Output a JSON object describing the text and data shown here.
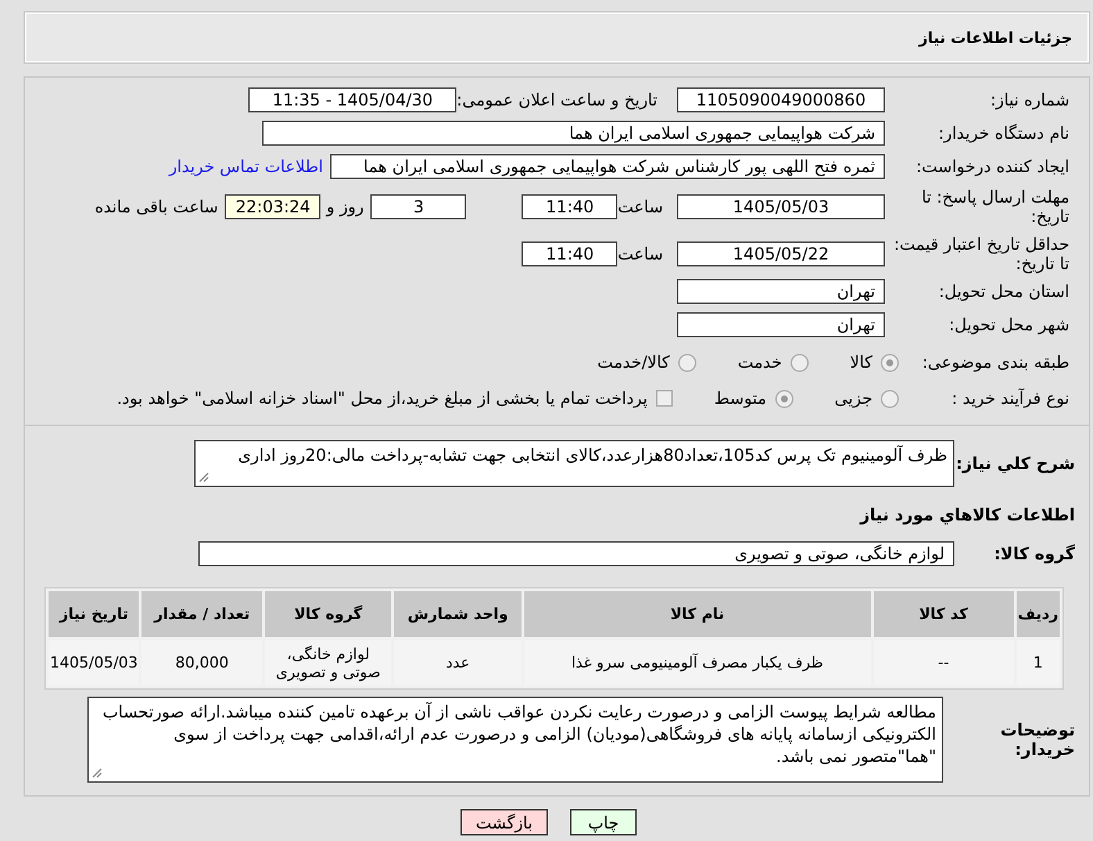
{
  "header": {
    "title": "جزئیات اطلاعات نیاز"
  },
  "fields": {
    "need_number_label": "شماره نیاز:",
    "need_number": "1105090049000860",
    "announce_label": "تاریخ و ساعت اعلان عمومی:",
    "announce_value": "1405/04/30 - 11:35",
    "buyer_label": "نام دستگاه خریدار:",
    "buyer": "شرکت هواپیمایی جمهوری اسلامی ایران هما",
    "requester_label": "ایجاد کننده درخواست:",
    "requester": "ثمره فتح اللهی پور کارشناس شرکت هواپیمایی جمهوری اسلامی ایران هما",
    "contact_link": "اطلاعات تماس خریدار",
    "deadline_label": "مهلت ارسال پاسخ: تا تاریخ:",
    "deadline_date": "1405/05/03",
    "deadline_time_label": "ساعت",
    "deadline_time": "11:40",
    "days": "3",
    "days_label": "روز و",
    "remaining": "22:03:24",
    "remaining_label": "ساعت باقی مانده",
    "validity_label": "حداقل تاریخ اعتبار قیمت: تا تاریخ:",
    "validity_date": "1405/05/22",
    "validity_time_label": "ساعت",
    "validity_time": "11:40",
    "province_label": "استان محل تحویل:",
    "province": "تهران",
    "city_label": "شهر محل تحویل:",
    "city": "تهران"
  },
  "category": {
    "label": "طبقه بندی موضوعی:",
    "options": [
      {
        "label": "کالا",
        "selected": true
      },
      {
        "label": "خدمت",
        "selected": false
      },
      {
        "label": "کالا/خدمت",
        "selected": false
      }
    ]
  },
  "process": {
    "label": "نوع فرآیند خرید :",
    "options": [
      {
        "label": "جزیی",
        "selected": false
      },
      {
        "label": "متوسط",
        "selected": true
      }
    ],
    "payment_checked": false,
    "payment_text": "پرداخت تمام یا بخشی از مبلغ خرید،از محل \"اسناد خزانه اسلامی\" خواهد بود."
  },
  "description": {
    "label": "شرح کلي نياز:",
    "text": "ظرف آلومینیوم تک پرس کد105،تعداد80هزارعدد،کالای انتخابی جهت تشابه-پرداخت مالی:20روز اداری"
  },
  "goods_heading": "اطلاعات کالاهاي مورد نياز",
  "goods_group": {
    "label": "گروه کالا:",
    "value": "لوازم خانگی، صوتی و تصویری"
  },
  "table": {
    "columns": [
      "ردیف",
      "کد کالا",
      "نام کالا",
      "واحد شمارش",
      "گروه کالا",
      "تعداد / مقدار",
      "تاریخ نیاز"
    ],
    "rows": [
      [
        "1",
        "--",
        "ظرف یکبار مصرف آلومینیومی سرو غذا",
        "عدد",
        "لوازم خانگی، صوتی و تصویری",
        "80,000",
        "1405/05/03"
      ]
    ]
  },
  "notes": {
    "label": "توضیحات خریدار:",
    "text": "مطالعه شرایط پیوست الزامی و درصورت رعایت نکردن عواقب ناشی از آن برعهده تامین کننده میباشد.ارائه صورتحساب الکترونیکی ازسامانه پایانه های فروشگاهی(مودیان) الزامی و درصورت عدم ارائه،اقدامی جهت پرداخت از سوی \"هما\"متصور نمی باشد."
  },
  "buttons": [
    {
      "label": "چاپ",
      "kind": "print"
    },
    {
      "label": "بازگشت",
      "kind": "back"
    }
  ]
}
